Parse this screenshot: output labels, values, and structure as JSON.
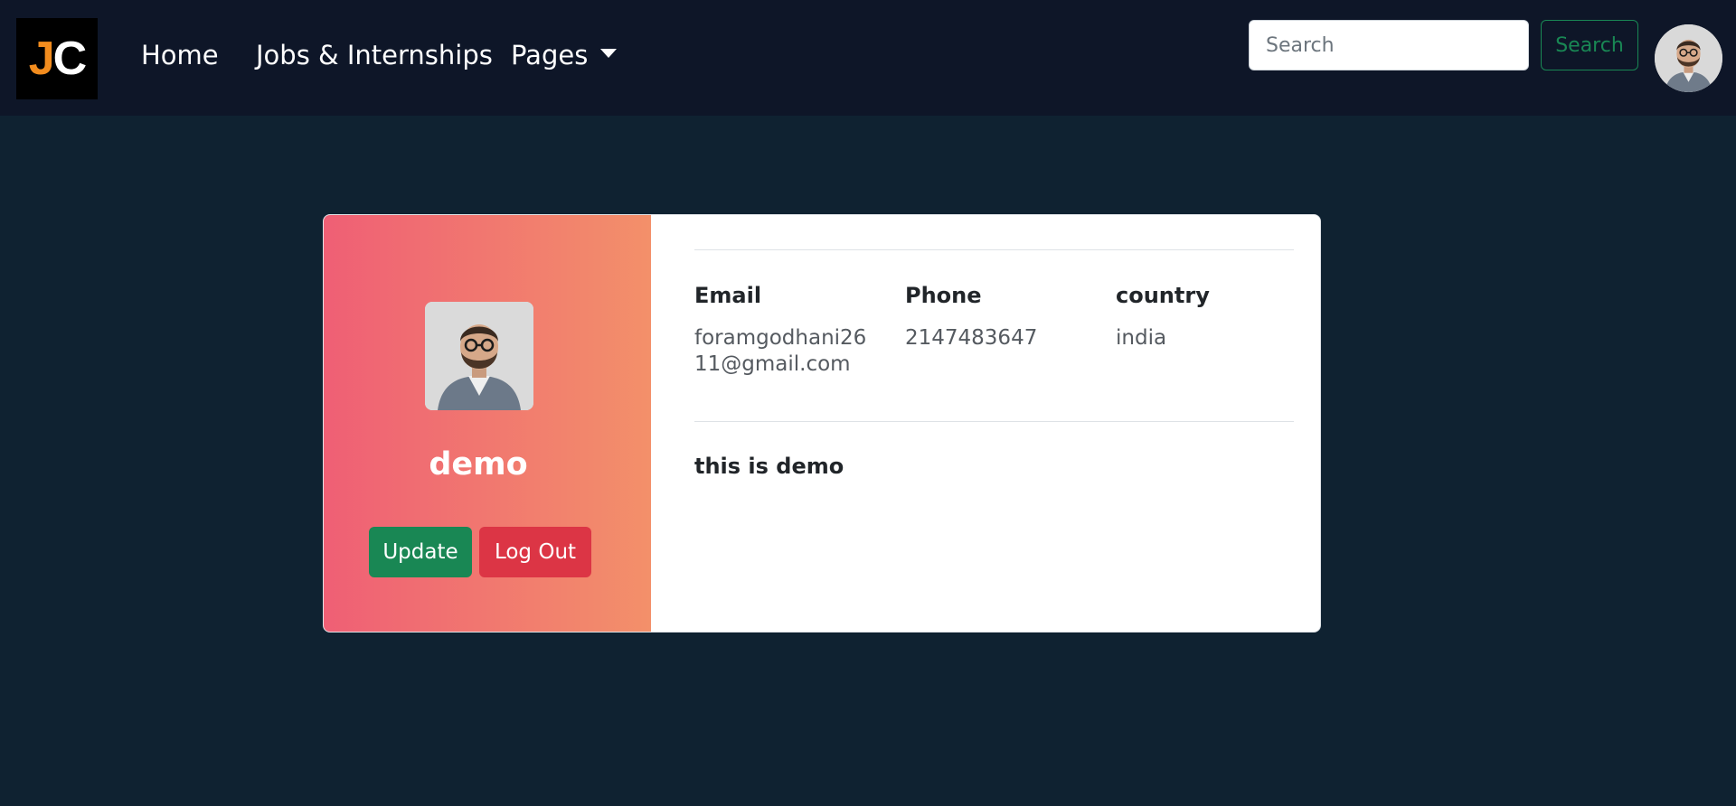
{
  "navbar": {
    "logo": {
      "letter1": "J",
      "letter2": "C"
    },
    "links": {
      "home": "Home",
      "jobs": "Jobs & Internships",
      "pages": "Pages"
    },
    "search": {
      "placeholder": "Search",
      "button_label": "Search"
    }
  },
  "profile": {
    "name": "demo",
    "update_label": "Update",
    "logout_label": "Log Out",
    "fields": {
      "email_label": "Email",
      "email_value": "foramgodhani2611@gmail.com",
      "phone_label": "Phone",
      "phone_value": "2147483647",
      "country_label": "country",
      "country_value": "india"
    },
    "bio": "this is demo"
  },
  "colors": {
    "nav_bg": "#0e1628",
    "page_bg": "#0f2231",
    "gradient_start": "#ef5f75",
    "gradient_end": "#f3906a",
    "success": "#198754",
    "danger": "#dc3545",
    "logo_accent": "#f28c1e"
  }
}
